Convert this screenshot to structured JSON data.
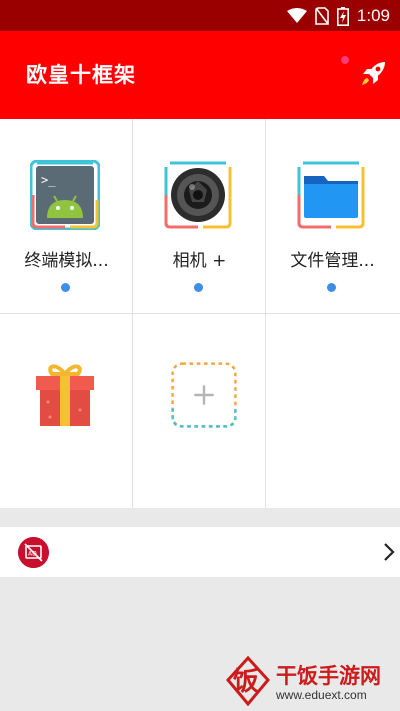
{
  "status_bar": {
    "time": "1:09",
    "icons": [
      "wifi-icon",
      "no-sim-icon",
      "battery-charging-icon"
    ]
  },
  "app_bar": {
    "title": "欧皇十框架",
    "action_icon": "rocket-icon",
    "colors": {
      "bar": "#ff0000",
      "status": "#9a0000"
    }
  },
  "grid": {
    "apps": [
      {
        "label": "终端模拟...",
        "icon": "android-terminal-icon",
        "has_dot": true
      },
      {
        "label": "相机 +",
        "icon": "camera-lens-icon",
        "has_dot": true
      },
      {
        "label": "文件管理...",
        "icon": "folder-icon",
        "has_dot": true
      },
      {
        "label": "",
        "icon": "gift-icon",
        "has_dot": false
      },
      {
        "label": "",
        "icon": "add-icon",
        "has_dot": false
      }
    ]
  },
  "ad_bar": {
    "icon": "no-ads-icon",
    "chevron": "chevron-right-icon"
  },
  "watermark": {
    "logo_char": "饭",
    "title": "干饭手游网",
    "url": "www.eduext.com"
  }
}
